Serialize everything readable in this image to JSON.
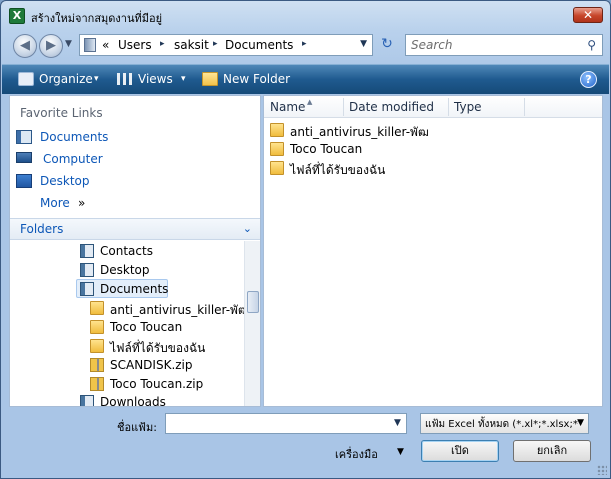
{
  "window": {
    "title": "สร้างใหม่จากสมุดงานที่มีอยู่",
    "close_label": "✕"
  },
  "address": {
    "back_glyph": "◀",
    "forward_glyph": "▶",
    "history_glyph": "▼",
    "overflow": "«",
    "segments": [
      "Users",
      "saksit",
      "Documents"
    ],
    "separator_glyph": "▸",
    "dropdown_glyph": "▼",
    "refresh_glyph": "↻"
  },
  "search": {
    "placeholder": "Search",
    "icon_glyph": "⚲"
  },
  "toolbar": {
    "organize": "Organize",
    "views": "Views",
    "new_folder": "New Folder",
    "caret": "▾",
    "help_glyph": "?"
  },
  "left": {
    "favorites_header": "Favorite Links",
    "favorites": [
      {
        "label": "Documents",
        "icon": "documents-icon"
      },
      {
        "label": "Computer",
        "icon": "computer-icon"
      },
      {
        "label": "Desktop",
        "icon": "desktop-icon"
      },
      {
        "label": "More",
        "icon": ""
      }
    ],
    "more_glyph": "»",
    "folders_label": "Folders",
    "folders_chev": "⌄",
    "tree": [
      {
        "label": "Contacts",
        "icon": "library-icon"
      },
      {
        "label": "Desktop",
        "icon": "library-icon"
      },
      {
        "label": "Documents",
        "icon": "library-icon",
        "selected": true
      },
      {
        "label": "anti_antivirus_killer-พัฒ",
        "icon": "folder-icon"
      },
      {
        "label": "Toco Toucan",
        "icon": "folder-icon"
      },
      {
        "label": "ไฟล์ที่ได้รับของฉัน",
        "icon": "folder-icon"
      },
      {
        "label": "SCANDISK.zip",
        "icon": "zip-icon"
      },
      {
        "label": "Toco Toucan.zip",
        "icon": "zip-icon"
      },
      {
        "label": "Downloads",
        "icon": "library-icon"
      }
    ]
  },
  "right": {
    "columns": [
      "Name",
      "Date modified",
      "Type"
    ],
    "sort_glyph": "▲",
    "files": [
      {
        "label": "anti_antivirus_killer-พัฒ",
        "icon": "folder-icon"
      },
      {
        "label": "Toco Toucan",
        "icon": "folder-icon"
      },
      {
        "label": "ไฟล์ที่ได้รับของฉัน",
        "icon": "folder-icon"
      }
    ]
  },
  "bottom": {
    "filename_label": "ชื่อแฟ้ม:",
    "filename_value": "",
    "filename_drop_glyph": "▼",
    "filetype_value": "แฟ้ม Excel ทั้งหมด (*.xl*;*.xlsx;*",
    "filetype_caret": "▼",
    "tools_label": "เครื่องมือ",
    "tools_caret": "▼",
    "open_label": "เปิด",
    "cancel_label": "ยกเลิก"
  },
  "colors": {
    "accent_link": "#0d57b7",
    "toolbar": "#1f5a8f",
    "close": "#c7452a"
  }
}
